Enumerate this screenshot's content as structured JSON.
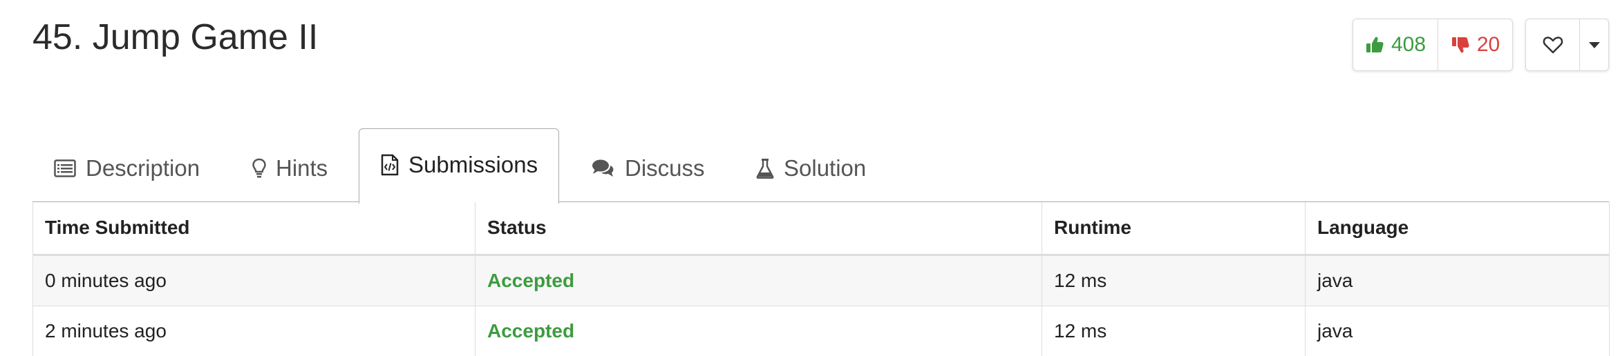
{
  "problem": {
    "title": "45. Jump Game II",
    "likes": "408",
    "dislikes": "20"
  },
  "icons": {
    "like": "thumbs-up-icon",
    "dislike": "thumbs-down-icon",
    "favorite": "heart-outline-icon",
    "more": "caret-down-icon"
  },
  "colors": {
    "accepted": "#3c9c3f",
    "like": "#3c9c3f",
    "dislike": "#d9413d"
  },
  "tabs": [
    {
      "label": "Description",
      "icon": "list-icon",
      "active": false
    },
    {
      "label": "Hints",
      "icon": "lightbulb-icon",
      "active": false
    },
    {
      "label": "Submissions",
      "icon": "code-file-icon",
      "active": true
    },
    {
      "label": "Discuss",
      "icon": "comments-icon",
      "active": false
    },
    {
      "label": "Solution",
      "icon": "flask-icon",
      "active": false
    }
  ],
  "table": {
    "headers": [
      "Time Submitted",
      "Status",
      "Runtime",
      "Language"
    ],
    "rows": [
      [
        "0 minutes ago",
        "Accepted",
        "12 ms",
        "java"
      ],
      [
        "2 minutes ago",
        "Accepted",
        "12 ms",
        "java"
      ]
    ]
  }
}
